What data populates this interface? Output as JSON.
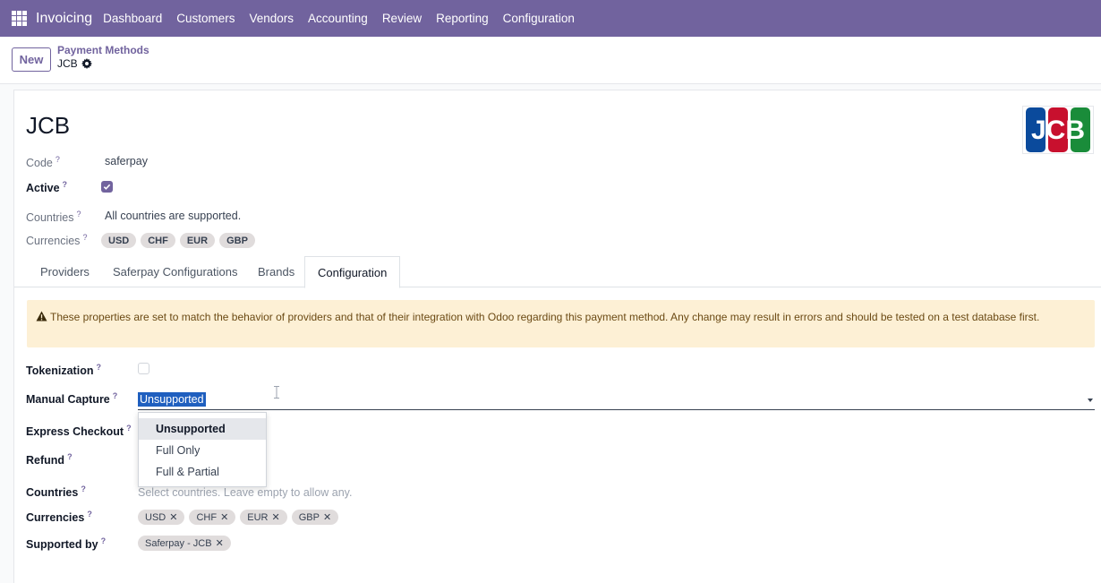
{
  "navbar": {
    "app_name": "Invoicing",
    "menu": [
      "Dashboard",
      "Customers",
      "Vendors",
      "Accounting",
      "Review",
      "Reporting",
      "Configuration"
    ]
  },
  "control_panel": {
    "new_button": "New",
    "breadcrumb_parent": "Payment Methods",
    "breadcrumb_current": "JCB"
  },
  "record": {
    "title": "JCB",
    "logo_text": "JCB",
    "code_label": "Code",
    "code_value": "saferpay",
    "active_label": "Active",
    "active_checked": true,
    "countries_label": "Countries",
    "countries_value": "All countries are supported.",
    "currencies_label": "Currencies",
    "currencies": [
      "USD",
      "CHF",
      "EUR",
      "GBP"
    ]
  },
  "tabs": [
    "Providers",
    "Saferpay Configurations",
    "Brands",
    "Configuration"
  ],
  "active_tab": "Configuration",
  "configuration": {
    "warning": "These properties are set to match the behavior of providers and that of their integration with Odoo regarding this payment method. Any change may result in errors and should be tested on a test database first.",
    "tokenization_label": "Tokenization",
    "tokenization_checked": false,
    "manual_capture_label": "Manual Capture",
    "manual_capture_value": "Unsupported",
    "manual_capture_options": [
      "Unsupported",
      "Full Only",
      "Full & Partial"
    ],
    "express_checkout_label": "Express Checkout",
    "refund_label": "Refund",
    "countries_label": "Countries",
    "countries_placeholder": "Select countries. Leave empty to allow any.",
    "currencies_label": "Currencies",
    "currencies": [
      "USD",
      "CHF",
      "EUR",
      "GBP"
    ],
    "supported_by_label": "Supported by",
    "supported_by": [
      "Saferpay - JCB"
    ]
  },
  "help_marker": "?",
  "remove_marker": "✕",
  "colors": {
    "brand": "#71639e",
    "warning_bg": "#fdf0d5",
    "selection": "#1f5fbf"
  }
}
